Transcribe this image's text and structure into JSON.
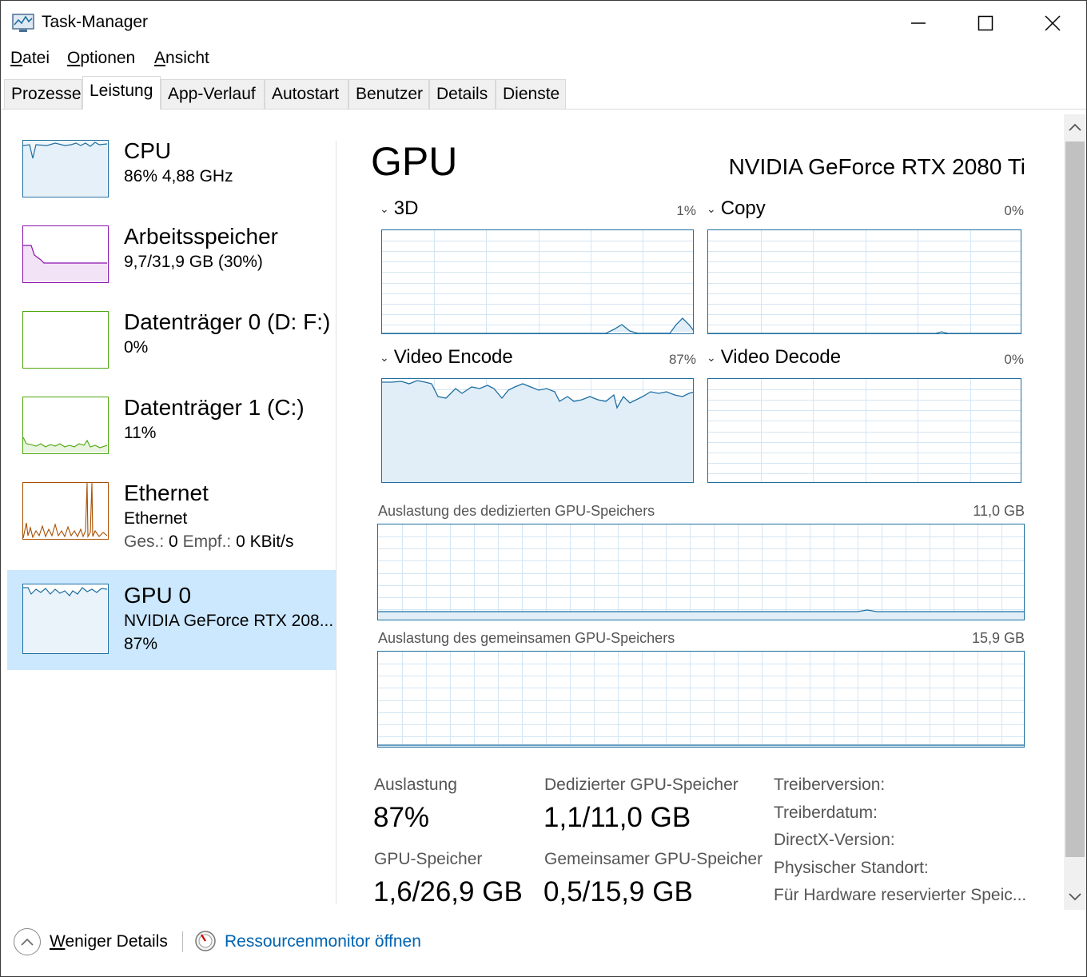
{
  "window": {
    "title": "Task-Manager"
  },
  "menu": [
    {
      "accel": "D",
      "rest": "atei"
    },
    {
      "accel": "O",
      "rest": "ptionen"
    },
    {
      "accel": "A",
      "rest": "nsicht"
    }
  ],
  "tabs": [
    "Prozesse",
    "Leistung",
    "App-Verlauf",
    "Autostart",
    "Benutzer",
    "Details",
    "Dienste"
  ],
  "active_tab": "Leistung",
  "sidebar": {
    "items": [
      {
        "title": "CPU",
        "line1": "86% 4,88 GHz",
        "color": "#1e6fa0"
      },
      {
        "title": "Arbeitsspeicher",
        "line1": "9,7/31,9 GB (30%)",
        "color": "#8b12ae"
      },
      {
        "title": "Datenträger 0 (D: F:)",
        "line1": "0%",
        "color": "#4da60c"
      },
      {
        "title": "Datenträger 1 (C:)",
        "line1": "11%",
        "color": "#4da60c"
      },
      {
        "title": "Ethernet",
        "line1": "Ethernet",
        "send_label": "Ges.:",
        "send_value": "0",
        "recv_label": "Empf.:",
        "recv_value": "0 KBit/s",
        "color": "#a74f01"
      },
      {
        "title": "GPU 0",
        "line1": "NVIDIA GeForce RTX 208...",
        "line2": "87%",
        "color": "#1e6fa0"
      }
    ]
  },
  "main": {
    "title": "GPU",
    "device": "NVIDIA GeForce RTX 2080 Ti",
    "engines": [
      {
        "label": "3D",
        "percent": "1%"
      },
      {
        "label": "Copy",
        "percent": "0%"
      },
      {
        "label": "Video Encode",
        "percent": "87%"
      },
      {
        "label": "Video Decode",
        "percent": "0%"
      }
    ],
    "dedicated_memory": {
      "label": "Auslastung des dedizierten GPU-Speichers",
      "max": "11,0 GB"
    },
    "shared_memory": {
      "label": "Auslastung des gemeinsamen GPU-Speichers",
      "max": "15,9 GB"
    },
    "stats": {
      "utilization": {
        "label": "Auslastung",
        "value": "87%"
      },
      "dedicated": {
        "label": "Dedizierter GPU-Speicher",
        "value": "1,1/11,0 GB"
      },
      "gpu_memory": {
        "label": "GPU-Speicher",
        "value": "1,6/26,9 GB"
      },
      "shared": {
        "label": "Gemeinsamer GPU-Speicher",
        "value": "0,5/15,9 GB"
      }
    },
    "info_labels": [
      "Treiberversion:",
      "Treiberdatum:",
      "DirectX-Version:",
      "Physischer Standort:",
      "Für Hardware reservierter Speic..."
    ]
  },
  "footer": {
    "less_details_accel": "W",
    "less_details_rest": "eniger Details",
    "resource_monitor": "Ressourcenmonitor öffnen"
  },
  "colors": {
    "gpu": "#1e6fa0",
    "selected": "#cce8ff",
    "link": "#0063b1"
  }
}
